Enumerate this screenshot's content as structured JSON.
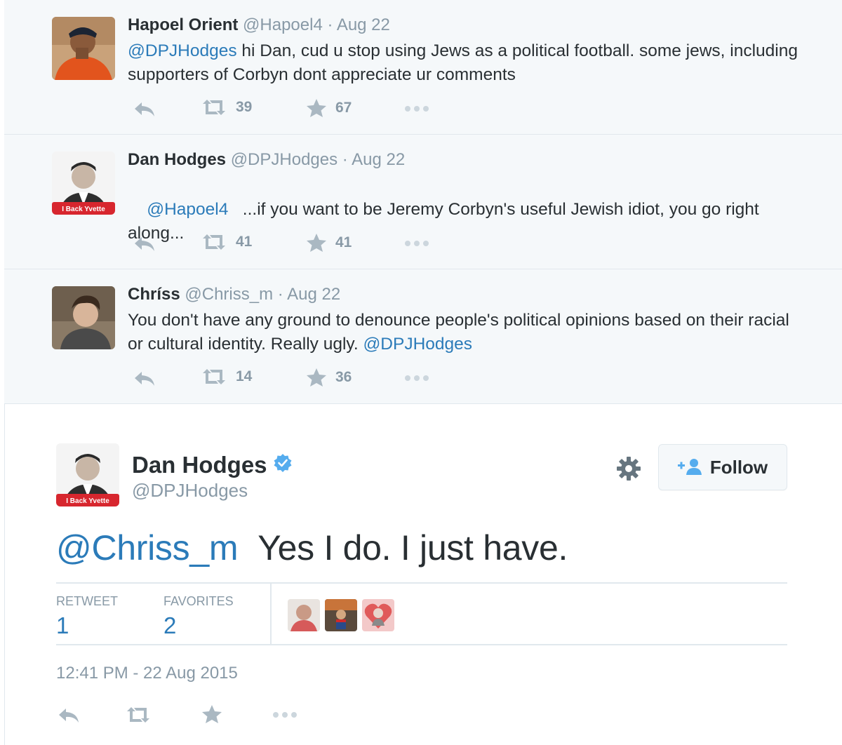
{
  "context_tweets": [
    {
      "name": "Hapoel Orient",
      "handle": "@Hapoel4",
      "time": "Aug 22",
      "mention": "@DPJHodges",
      "text": " hi Dan, cud u stop using Jews as a political football. some jews, including supporters of Corbyn dont appreciate ur comments",
      "retweets": "39",
      "favorites": "67",
      "avatar_icon": "avatar-hapoel-orient"
    },
    {
      "name": "Dan Hodges",
      "handle": "@DPJHodges",
      "time": "Aug 22",
      "mention": "@Hapoel4",
      "text": "   ...if you want to be Jeremy Corbyn's useful Jewish idiot, you go right along...",
      "retweets": "41",
      "favorites": "41",
      "avatar_icon": "avatar-dan-hodges",
      "avatar_badge": "I Back Yvette"
    },
    {
      "name": "Chríss",
      "handle": "@Chriss_m",
      "time": "Aug 22",
      "text": "You don't have any ground to denounce people's political opinions based on their racial or cultural identity. Really ugly. ",
      "mention_trailing": "@DPJHodges",
      "retweets": "14",
      "favorites": "36",
      "avatar_icon": "avatar-chriss"
    }
  ],
  "separator": " · ",
  "main_tweet": {
    "name": "Dan Hodges",
    "handle": "@DPJHodges",
    "avatar_badge": "I Back Yvette",
    "follow_label": "Follow",
    "mention": "@Chriss_m",
    "text": "Yes I do. I just have.",
    "retweet_label": "RETWEET",
    "retweet_count": "1",
    "favorites_label": "FAVORITES",
    "favorites_count": "2",
    "timestamp": "12:41 PM - 22 Aug 2015"
  },
  "colors": {
    "link": "#2b7bb9",
    "muted": "#8899a6",
    "text": "#292f33",
    "context_bg": "#f5f8fa",
    "verified": "#55acee"
  }
}
